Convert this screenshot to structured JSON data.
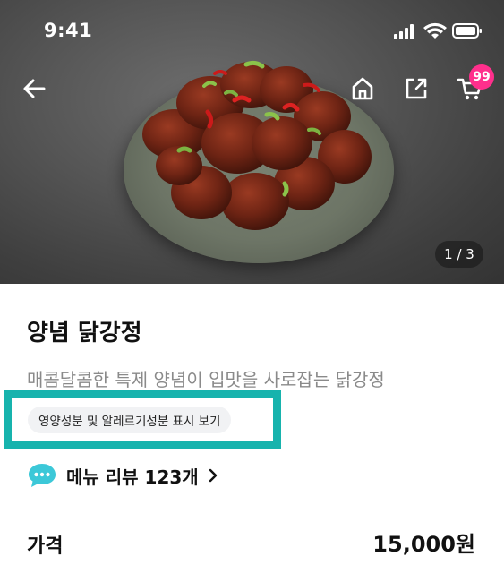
{
  "status_bar": {
    "time": "9:41"
  },
  "header": {
    "cart_badge": "99",
    "icons": [
      "back-arrow-icon",
      "home-icon",
      "share-icon",
      "cart-icon"
    ]
  },
  "gallery": {
    "page_indicator": "1 / 3"
  },
  "product": {
    "title": "양념 닭강정",
    "description": "매콤달콤한 특제 양념이 입맛을 사로잡는 닭강정",
    "nutrition_chip": "영양성분 및 알레르기성분 표시 보기"
  },
  "review": {
    "label": "메뉴 리뷰 123개"
  },
  "price": {
    "label": "가격",
    "value": "15,000원"
  },
  "colors": {
    "highlight": "#17b3ad",
    "badge": "#ff2f8c",
    "review_icon": "#3cc8d8"
  }
}
